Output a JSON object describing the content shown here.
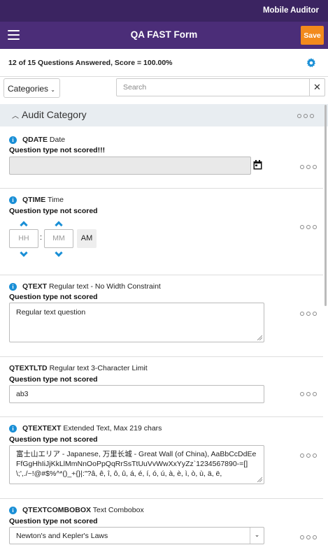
{
  "app": {
    "name": "Mobile Auditor"
  },
  "header": {
    "title": "QA FAST Form",
    "save_label": "Save"
  },
  "summary": {
    "text": "12 of 15 Questions Answered, Score = 100.00%"
  },
  "filter": {
    "categories_label": "Categories",
    "search_placeholder": "Search",
    "clear_glyph": "✕"
  },
  "category": {
    "label": "Audit Category"
  },
  "questions": [
    {
      "code": "QDATE",
      "desc": "Date",
      "type_text": "Question type not scored!!!",
      "value": ""
    },
    {
      "code": "QTIME",
      "desc": "Time",
      "type_text": "Question type not scored",
      "hh": "HH",
      "mm": "MM",
      "ampm": "AM",
      "sep": ":"
    },
    {
      "code": "QTEXT",
      "desc": "Regular text - No Width Constraint",
      "type_text": "Question type not scored",
      "value": "Regular text question"
    },
    {
      "code": "QTEXTLTD",
      "desc": "Regular text 3-Character Limit",
      "type_text": "Question type not scored",
      "value": "ab3"
    },
    {
      "code": "QTEXTEXT",
      "desc": "Extended Text, Max 219 chars",
      "type_text": "Question type not scored",
      "value": "富士山エリア - Japanese, 万里长城 - Great Wall (of China), AaBbCcDdEeFfGgHhIiJjKkLlMmNnOoPpQqRrSsTtUuVvWwXxYyZz`1234567890-=[]\\;',./~!@#$%^*()_+{}|:\"?â, ê, î, ô, û, á, é, í, ó, ú, à, è, ì, ò, ù, ä, ë,"
    },
    {
      "code": "QTEXTCOMBOBOX",
      "desc": "Text Combobox",
      "type_text": "Question type not scored",
      "value": "Newton's and Kepler's Laws"
    }
  ],
  "icons": {
    "info": "info-icon",
    "calendar": "calendar-icon",
    "gear": "gear-icon",
    "more": "more-options-icon"
  },
  "colors": {
    "header": "#4b2d78",
    "topbar": "#3b2461",
    "save": "#f28a1c",
    "accent": "#1a8fd6"
  }
}
